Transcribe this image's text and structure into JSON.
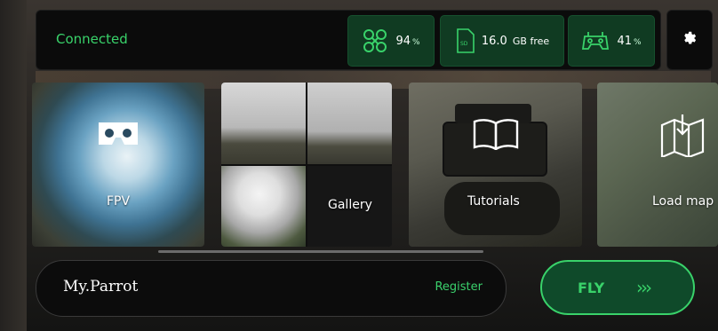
{
  "status": {
    "connection": "Connected",
    "drone_battery": {
      "value": "94",
      "unit": "%",
      "icon": "drone-icon"
    },
    "sd_storage": {
      "value": "16.0",
      "unit": "GB free",
      "icon": "sd-card-icon"
    },
    "controller_battery": {
      "value": "41",
      "unit": "%",
      "icon": "controller-icon"
    },
    "settings_icon": "gear-icon"
  },
  "tiles": [
    {
      "label": "FPV",
      "icon": "vr-headset-icon"
    },
    {
      "label": "Gallery"
    },
    {
      "label": "Tutorials",
      "icon": "book-icon"
    },
    {
      "label": "Load map",
      "icon": "map-download-icon"
    }
  ],
  "bottom": {
    "brand": "My.Parrot",
    "register": "Register",
    "fly": "FLY",
    "fly_arrows": "›››"
  },
  "colors": {
    "accent": "#39d26a",
    "pill_bg": "#103b22",
    "panel_bg": "#0b0b0b"
  }
}
